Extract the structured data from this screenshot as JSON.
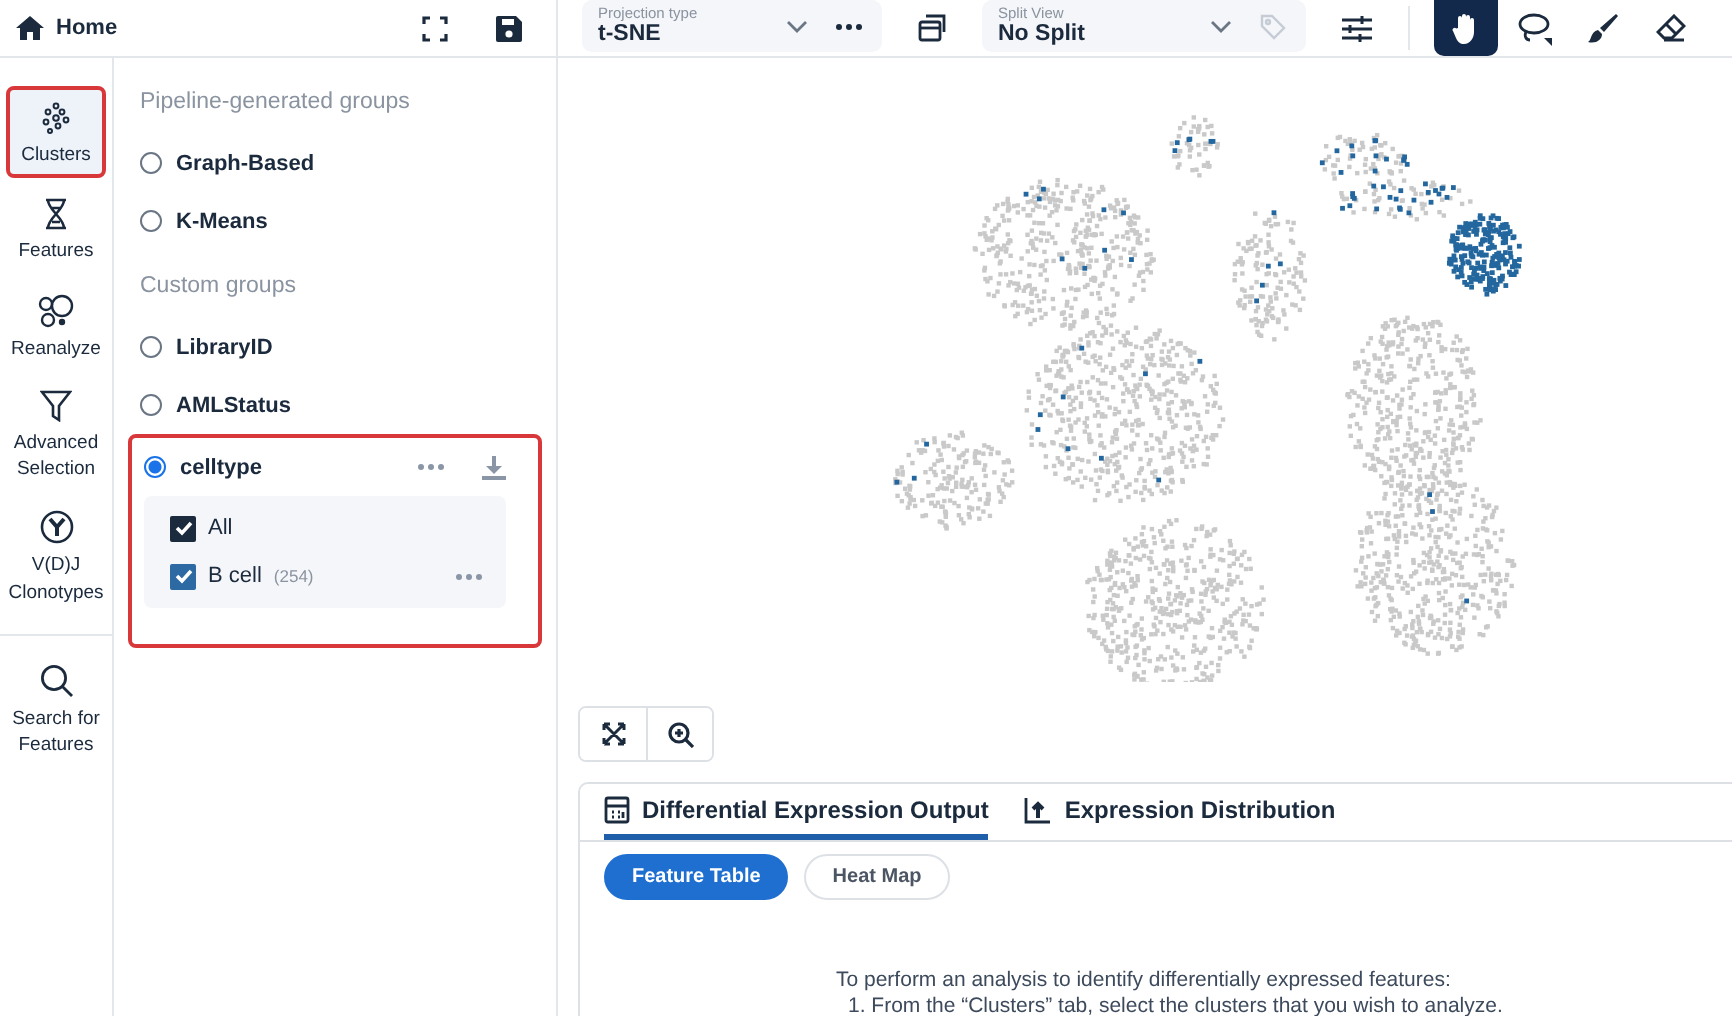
{
  "header": {
    "title": "Home"
  },
  "rail": [
    {
      "label": "Clusters",
      "kind": "clusters",
      "selected": true
    },
    {
      "label": "Features",
      "kind": "features",
      "selected": false
    },
    {
      "label": "Reanalyze",
      "kind": "reanalyze",
      "selected": false
    },
    {
      "label": "Advanced Selection",
      "kind": "filter",
      "selected": false
    },
    {
      "label": "V(D)J Clonotypes",
      "kind": "vdj",
      "selected": false
    },
    {
      "label": "Search for Features",
      "kind": "search",
      "selected": false
    }
  ],
  "pipeline_groups": {
    "heading": "Pipeline-generated groups",
    "items": [
      {
        "label": "Graph-Based",
        "selected": false
      },
      {
        "label": "K-Means",
        "selected": false
      }
    ]
  },
  "custom_groups": {
    "heading": "Custom groups",
    "items": [
      {
        "label": "LibraryID",
        "selected": false
      },
      {
        "label": "AMLStatus",
        "selected": false
      },
      {
        "label": "celltype",
        "selected": true,
        "expanded": true,
        "subitems": [
          {
            "label": "All",
            "checked": true,
            "kind": "all"
          },
          {
            "label": "B cell",
            "count": "(254)",
            "checked": true,
            "kind": "cluster"
          }
        ]
      }
    ]
  },
  "toolbar": {
    "projection": {
      "label": "Projection type",
      "value": "t-SNE"
    },
    "split": {
      "label": "Split View",
      "value": "No Split"
    },
    "tools": [
      {
        "kind": "hand",
        "selected": true
      },
      {
        "kind": "lasso",
        "selected": false
      },
      {
        "kind": "brush",
        "selected": false
      },
      {
        "kind": "eraser",
        "selected": false
      }
    ]
  },
  "tabs": [
    {
      "label": "Differential Expression Output",
      "kind": "table",
      "selected": true
    },
    {
      "label": "Expression Distribution",
      "kind": "distribution",
      "selected": false
    }
  ],
  "views": [
    {
      "label": "Feature Table",
      "selected": true
    },
    {
      "label": "Heat Map",
      "selected": false
    }
  ],
  "instructions": [
    "To perform an analysis to identify differentially expressed features:",
    "1. From the “Clusters” tab, select the clusters that you wish to analyze."
  ]
}
